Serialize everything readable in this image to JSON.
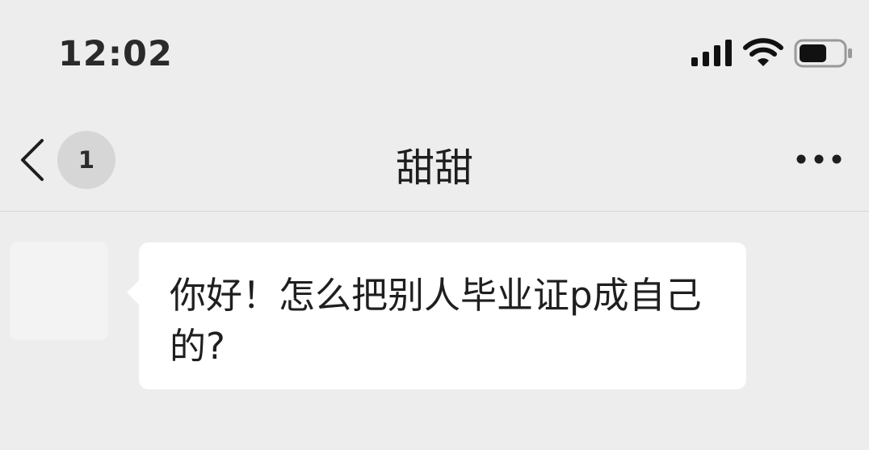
{
  "status_bar": {
    "time": "12:02",
    "signal_icon": "cellular-signal-icon",
    "wifi_icon": "wifi-icon",
    "battery_icon": "battery-icon"
  },
  "nav": {
    "back_icon": "chevron-left-icon",
    "unread_count": "1",
    "title": "甜甜",
    "more_icon": "more-horizontal-icon"
  },
  "messages": [
    {
      "sender": "incoming",
      "text": "你好！怎么把别人毕业证p成自己的?"
    }
  ],
  "colors": {
    "background": "#ededed",
    "bubble": "#ffffff",
    "badge": "#d6d6d6",
    "text": "#1f1f1f"
  }
}
